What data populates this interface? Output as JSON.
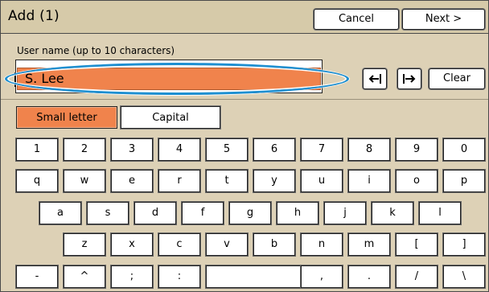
{
  "header": {
    "title": "Add (1)",
    "cancel_label": "Cancel",
    "next_label": "Next >"
  },
  "username": {
    "label": "User name (up to 10 characters)",
    "value": "S. Lee"
  },
  "edit": {
    "clear_label": "Clear",
    "left_icon": "cursor-left-icon",
    "right_icon": "cursor-right-icon"
  },
  "case_mode": {
    "small_label": "Small letter",
    "capital_label": "Capital",
    "selected": "Small letter"
  },
  "keyboard": {
    "row1": [
      "1",
      "2",
      "3",
      "4",
      "5",
      "6",
      "7",
      "8",
      "9",
      "0"
    ],
    "row2": [
      "q",
      "w",
      "e",
      "r",
      "t",
      "y",
      "u",
      "i",
      "o",
      "p"
    ],
    "row3": [
      "a",
      "s",
      "d",
      "f",
      "g",
      "h",
      "j",
      "k",
      "l"
    ],
    "row4": [
      "z",
      "x",
      "c",
      "v",
      "b",
      "n",
      "m",
      "[",
      "]"
    ],
    "row5": [
      "-",
      "^",
      ";",
      ":",
      "",
      ",",
      ".",
      "/",
      "\\"
    ]
  },
  "colors": {
    "accent": "#f0834c",
    "background": "#ddd1b6",
    "highlight": "#1d8fd1"
  }
}
